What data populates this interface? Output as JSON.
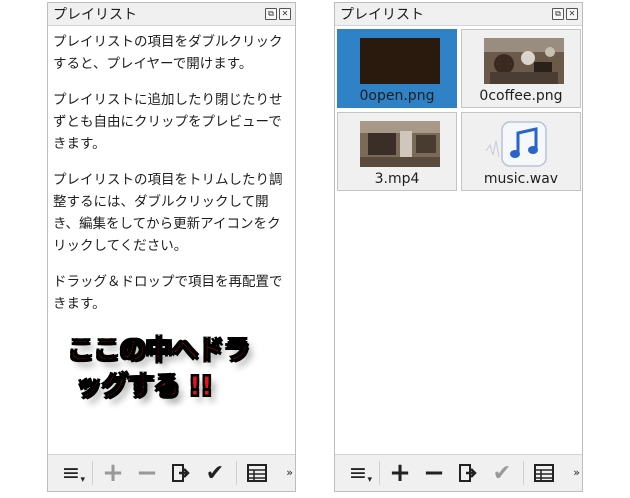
{
  "left_panel": {
    "title": "プレイリスト",
    "float_button": "⧉",
    "close_button": "✕",
    "help": [
      "プレイリストの項目をダブルクリックすると、プレイヤーで開けます。",
      "プレイリストに追加したり閉じたりせずとも自由にクリップをプレビューできます。",
      "プレイリストの項目をトリムしたり調整するには、ダブルクリックして開き、編集をしてから更新アイコンをクリックしてください。",
      "ドラッグ＆ドロップで項目を再配置できます。"
    ],
    "drop_hint_line1": "ここの中へドラ",
    "drop_hint_line2": "ッグする !!"
  },
  "right_panel": {
    "title": "プレイリスト",
    "float_button": "⧉",
    "close_button": "✕",
    "clips": [
      {
        "label": "0open.png",
        "selected": true
      },
      {
        "label": "0coffee.png",
        "selected": false
      },
      {
        "label": "3.mp4",
        "selected": false
      },
      {
        "label": "music.wav",
        "selected": false
      }
    ]
  },
  "toolbar": {
    "menu_icon": "≡",
    "menu_sub": "▾",
    "add_icon": "+",
    "remove_icon": "−",
    "update_icon": "⇒",
    "check_icon": "✔",
    "table_icon": "▦",
    "more_icon": "»"
  },
  "colors": {
    "selection": "#2f82c6",
    "hint_red": "#e8141a"
  }
}
